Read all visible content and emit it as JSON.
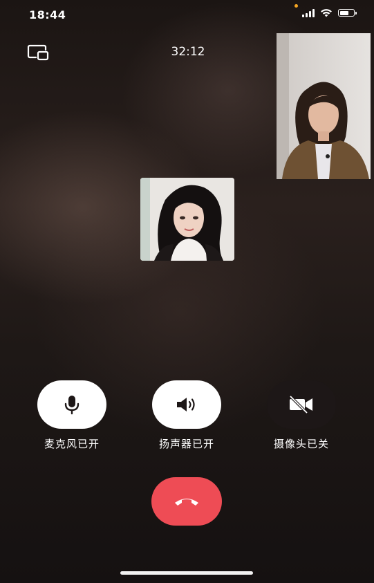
{
  "status_bar": {
    "time": "18:44",
    "battery_level": 0.7,
    "signal_icon": "cellular-signal-icon",
    "wifi_icon": "wifi-icon",
    "battery_icon": "battery-icon"
  },
  "call": {
    "duration": "32:12",
    "switch_icon": "switch-window-icon"
  },
  "controls": {
    "microphone": {
      "label": "麦克风已开",
      "icon": "microphone-icon",
      "state": "on"
    },
    "speaker": {
      "label": "扬声器已开",
      "icon": "speaker-icon",
      "state": "on"
    },
    "camera": {
      "label": "摄像头已关",
      "icon": "camera-off-icon",
      "state": "off"
    },
    "hangup": {
      "icon": "hang-up-icon",
      "color": "#ee4c55"
    }
  },
  "colors": {
    "hangup_red": "#ee4c55",
    "button_light": "#ffffff",
    "button_dark": "#1d1717",
    "status_dot": "#f5a623"
  }
}
